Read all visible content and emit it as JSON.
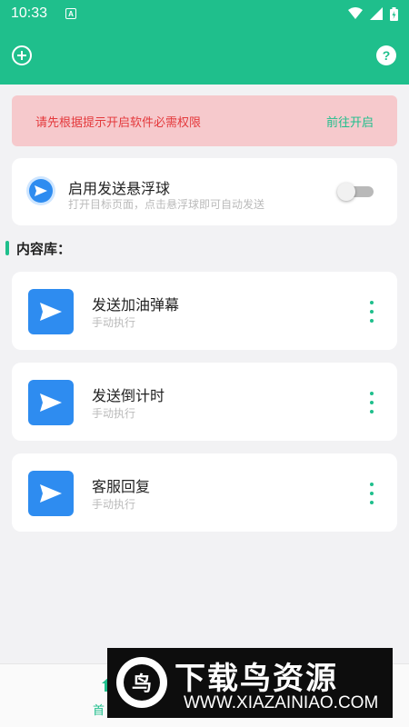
{
  "statusbar": {
    "time": "10:33",
    "a_label": "A"
  },
  "colors": {
    "accent": "#1fbf8c",
    "alert_bg": "#f6c9cc",
    "alert_text": "#e4393c",
    "icon_blue": "#2e8cf0"
  },
  "appbar": {
    "add_icon": "plus-circle-icon",
    "help_label": "?"
  },
  "alert": {
    "message": "请先根据提示开启软件必需权限",
    "action": "前往开启"
  },
  "float_ball": {
    "title": "启用发送悬浮球",
    "subtitle": "打开目标页面，点击悬浮球即可自动发送",
    "enabled": false
  },
  "library": {
    "title": "内容库：",
    "items": [
      {
        "name": "发送加油弹幕",
        "desc": "手动执行"
      },
      {
        "name": "发送倒计时",
        "desc": "手动执行"
      },
      {
        "name": "客服回复",
        "desc": "手动执行"
      }
    ]
  },
  "bottom_nav": {
    "home_label": "首"
  },
  "watermark": {
    "title": "下载鸟资源",
    "url": "WWW.XIAZAINIAO.COM",
    "logo_char": "鸟"
  }
}
